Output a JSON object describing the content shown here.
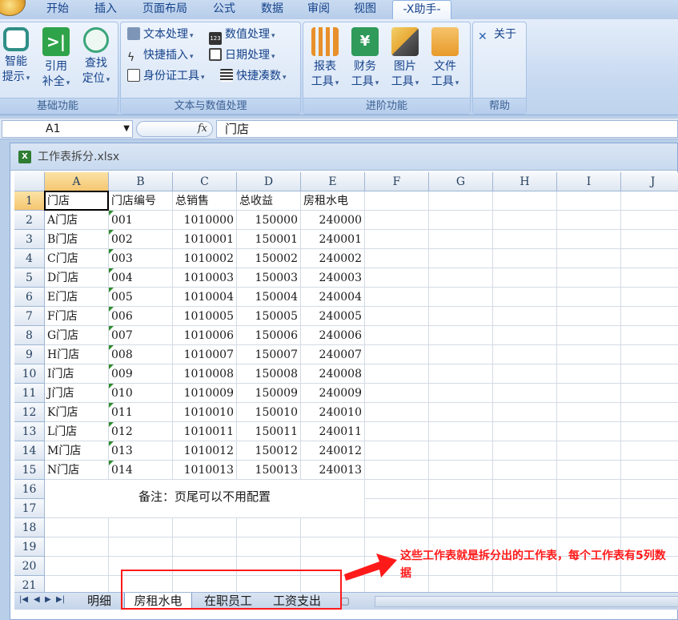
{
  "ribbon_tabs": [
    "开始",
    "插入",
    "页面布局",
    "公式",
    "数据",
    "审阅",
    "视图",
    "-X助手-"
  ],
  "groups": {
    "basic": {
      "label": "基础功能",
      "buttons": [
        {
          "line1": "智能",
          "line2": "提示"
        },
        {
          "line1": "引用",
          "line2": "补全"
        },
        {
          "line1": "查找",
          "line2": "定位"
        }
      ]
    },
    "text": {
      "label": "文本与数值处理",
      "buttons": [
        "文本处理",
        "数值处理",
        "快捷插入",
        "日期处理",
        "身份证工具",
        "快捷凑数"
      ]
    },
    "advanced": {
      "label": "进阶功能",
      "buttons": [
        {
          "line1": "报表",
          "line2": "工具"
        },
        {
          "line1": "财务",
          "line2": "工具"
        },
        {
          "line1": "图片",
          "line2": "工具"
        },
        {
          "line1": "文件",
          "line2": "工具"
        }
      ]
    },
    "help": {
      "label": "帮助",
      "about": "关于"
    }
  },
  "formula_bar": {
    "cell_ref": "A1",
    "fx": "fx",
    "value": "门店"
  },
  "workbook": {
    "title": "工作表拆分.xlsx"
  },
  "columns": [
    "A",
    "B",
    "C",
    "D",
    "E",
    "F",
    "G",
    "H",
    "I",
    "J"
  ],
  "rows": [
    "1",
    "2",
    "3",
    "4",
    "5",
    "6",
    "7",
    "8",
    "9",
    "10",
    "11",
    "12",
    "13",
    "14",
    "15",
    "16",
    "17",
    "18",
    "19",
    "20",
    "21"
  ],
  "table": {
    "headers": [
      "门店",
      "门店编号",
      "总销售",
      "总收益",
      "房租水电"
    ],
    "data": [
      [
        "A门店",
        "001",
        "1010000",
        "150000",
        "240000"
      ],
      [
        "B门店",
        "002",
        "1010001",
        "150001",
        "240001"
      ],
      [
        "C门店",
        "003",
        "1010002",
        "150002",
        "240002"
      ],
      [
        "D门店",
        "004",
        "1010003",
        "150003",
        "240003"
      ],
      [
        "E门店",
        "005",
        "1010004",
        "150004",
        "240004"
      ],
      [
        "F门店",
        "006",
        "1010005",
        "150005",
        "240005"
      ],
      [
        "G门店",
        "007",
        "1010006",
        "150006",
        "240006"
      ],
      [
        "H门店",
        "008",
        "1010007",
        "150007",
        "240007"
      ],
      [
        "I门店",
        "009",
        "1010008",
        "150008",
        "240008"
      ],
      [
        "J门店",
        "010",
        "1010009",
        "150009",
        "240009"
      ],
      [
        "K门店",
        "011",
        "1010010",
        "150010",
        "240010"
      ],
      [
        "L门店",
        "012",
        "1010011",
        "150011",
        "240011"
      ],
      [
        "M门店",
        "013",
        "1010012",
        "150012",
        "240012"
      ],
      [
        "N门店",
        "014",
        "1010013",
        "150013",
        "240013"
      ]
    ]
  },
  "remark": "备注：页尾可以不用配置",
  "sheet_tabs": [
    "明细",
    "房租水电",
    "在职员工",
    "工资支出"
  ],
  "active_sheet_index": 1,
  "annotation": {
    "text": "这些工作表就是拆分出的工作表，每个工作表有5列数据",
    "color": "#ff1a1a"
  }
}
